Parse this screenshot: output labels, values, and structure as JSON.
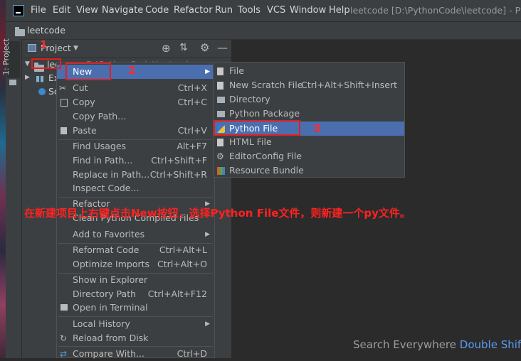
{
  "menubar": {
    "items": [
      "File",
      "Edit",
      "View",
      "Navigate",
      "Code",
      "Refactor",
      "Run",
      "Tools",
      "VCS",
      "Window",
      "Help"
    ],
    "title": "leetcode [D:\\PythonCode\\leetcode] - PyCha"
  },
  "navbar": {
    "crumb": "leetcode"
  },
  "stripe": {
    "tab": "1: Project"
  },
  "project": {
    "header": "Project",
    "tree": {
      "root_partial": "lee",
      "root_path": "D:\\PythonCode\\leetcode",
      "item2_partial": "Ex",
      "item3_partial": "Sc"
    }
  },
  "context_menu": {
    "items": [
      {
        "label": "New",
        "shortcut": "",
        "submenu": true,
        "icon": ""
      },
      {
        "label": "Cut",
        "shortcut": "Ctrl+X",
        "icon": "cut-icon"
      },
      {
        "label": "Copy",
        "shortcut": "Ctrl+C",
        "icon": "copy-icon"
      },
      {
        "label": "Copy Path...",
        "shortcut": "",
        "icon": ""
      },
      {
        "label": "Paste",
        "shortcut": "Ctrl+V",
        "icon": "paste-icon"
      },
      {
        "label": "Find Usages",
        "shortcut": "Alt+F7",
        "icon": ""
      },
      {
        "label": "Find in Path...",
        "shortcut": "Ctrl+Shift+F",
        "icon": ""
      },
      {
        "label": "Replace in Path...",
        "shortcut": "Ctrl+Shift+R",
        "icon": ""
      },
      {
        "label": "Inspect Code...",
        "shortcut": "",
        "icon": ""
      },
      {
        "label": "Refactor",
        "shortcut": "",
        "submenu": true,
        "icon": ""
      },
      {
        "label": "Clean Python Compiled Files",
        "shortcut": "",
        "icon": ""
      },
      {
        "label": "Add to Favorites",
        "shortcut": "",
        "submenu": true,
        "icon": ""
      },
      {
        "label": "Reformat Code",
        "shortcut": "Ctrl+Alt+L",
        "icon": ""
      },
      {
        "label": "Optimize Imports",
        "shortcut": "Ctrl+Alt+O",
        "icon": ""
      },
      {
        "label": "Show in Explorer",
        "shortcut": "",
        "icon": ""
      },
      {
        "label": "Directory Path",
        "shortcut": "Ctrl+Alt+F12",
        "icon": ""
      },
      {
        "label": "Open in Terminal",
        "shortcut": "",
        "icon": "terminal-icon"
      },
      {
        "label": "Local History",
        "shortcut": "",
        "submenu": true,
        "icon": ""
      },
      {
        "label": "Reload from Disk",
        "shortcut": "",
        "icon": "reload-icon"
      },
      {
        "label": "Compare With...",
        "shortcut": "Ctrl+D",
        "icon": "compare-icon"
      }
    ]
  },
  "new_submenu": {
    "items": [
      {
        "label": "File",
        "shortcut": "",
        "icon": "file-icon"
      },
      {
        "label": "New Scratch File",
        "shortcut": "Ctrl+Alt+Shift+Insert",
        "icon": "scratch-file-icon"
      },
      {
        "label": "Directory",
        "shortcut": "",
        "icon": "folder-icon"
      },
      {
        "label": "Python Package",
        "shortcut": "",
        "icon": "package-icon"
      },
      {
        "label": "Python File",
        "shortcut": "",
        "icon": "python-icon"
      },
      {
        "label": "HTML File",
        "shortcut": "",
        "icon": "html-icon"
      },
      {
        "label": "EditorConfig File",
        "shortcut": "",
        "icon": "gear-icon"
      },
      {
        "label": "Resource Bundle",
        "shortcut": "",
        "icon": "bundle-icon"
      }
    ]
  },
  "annotations": {
    "n1": "1",
    "n2": "2",
    "n3": "3",
    "caption": "在新建项目上右键点击New按钮，选择Python File文件，则新建一个py文件。"
  },
  "search_hint": {
    "text": "Search Everywhere",
    "key": "Double Shift"
  },
  "colors": {
    "selection": "#4b6eaf",
    "annotation": "#ff2222",
    "accent": "#589df6"
  }
}
